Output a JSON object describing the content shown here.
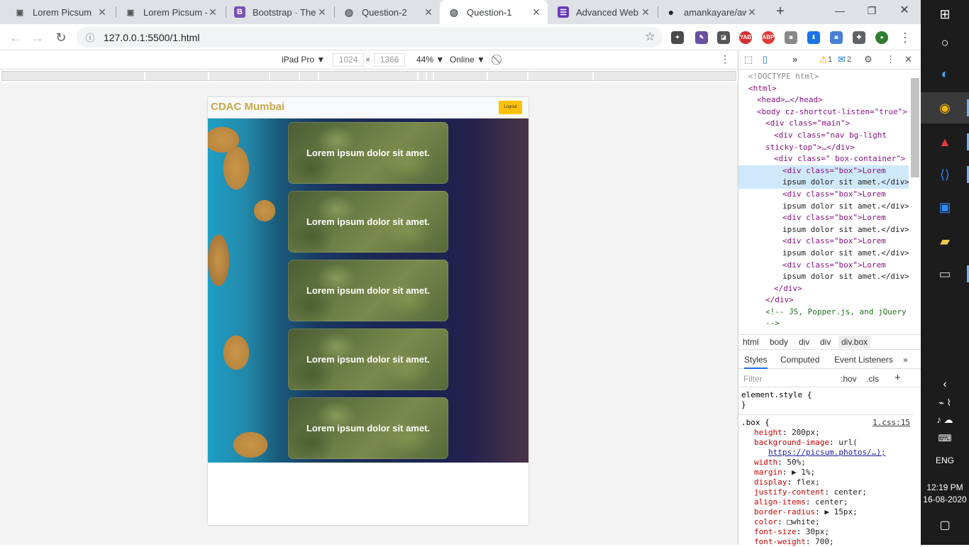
{
  "browser": {
    "tabs": [
      {
        "title": "Lorem Picsum"
      },
      {
        "title": "Lorem Picsum - I"
      },
      {
        "title": "Bootstrap · The r"
      },
      {
        "title": "Question-2"
      },
      {
        "title": "Question-1"
      },
      {
        "title": "Advanced Web P"
      },
      {
        "title": "amankayare/awp"
      }
    ],
    "new_tab": "+",
    "url": "127.0.0.1:5500/1.html"
  },
  "device_toolbar": {
    "device": "iPad Pro ▼",
    "width": "1024",
    "height": "1366",
    "times": "×",
    "zoom": "44% ▼",
    "network": "Online ▼"
  },
  "page": {
    "brand": "CDAC Mumbai",
    "logout": "Logout",
    "boxes": [
      "Lorem ipsum dolor sit amet.",
      "Lorem ipsum dolor sit amet.",
      "Lorem ipsum dolor sit amet.",
      "Lorem ipsum dolor sit amet.",
      "Lorem ipsum dolor sit amet."
    ]
  },
  "devtools": {
    "warnings": "1",
    "messages": "2",
    "dom": {
      "doctype": "<!DOCTYPE html>",
      "html": "<html>",
      "head": "<head>…</head>",
      "body_open": "<body cz-shortcut-listen=\"true\">",
      "main_open": "<div class=\"main\">",
      "nav_a": "<div class=\"nav bg-light",
      "nav_b": "sticky-top\">…</div>",
      "box_container": "<div class=\" box-container\">",
      "box_line_a": "<div class=\"box\">Lorem",
      "box_line_b": "ipsum dolor sit amet.</div>",
      "close_div": "</div>",
      "comment_a": "<!-- JS, Popper.js, and jQuery",
      "comment_b": "-->"
    },
    "breadcrumbs": [
      "html",
      "body",
      "div",
      "div",
      "div.box"
    ],
    "style_tabs": [
      "Styles",
      "Computed",
      "Event Listeners"
    ],
    "filter_placeholder": "Filter",
    "hov": ":hov",
    "cls": ".cls",
    "element_style": "element.style {",
    "element_close": "}",
    "rule_selector": ".box {",
    "rule_source": "1.css:15",
    "declarations": [
      {
        "prop": "height",
        "val": "200px;"
      },
      {
        "prop": "background-image",
        "val": "url("
      },
      {
        "prop": "",
        "val": "https://picsum.photos/…);"
      },
      {
        "prop": "width",
        "val": "50%;"
      },
      {
        "prop": "margin",
        "val": "▶ 1%;"
      },
      {
        "prop": "display",
        "val": "flex;"
      },
      {
        "prop": "justify-content",
        "val": "center;"
      },
      {
        "prop": "align-items",
        "val": "center;"
      },
      {
        "prop": "border-radius",
        "val": "▶ 15px;"
      },
      {
        "prop": "color",
        "val": "□white;"
      },
      {
        "prop": "font-size",
        "val": "30px;"
      },
      {
        "prop": "font-weight",
        "val": "700;"
      }
    ]
  },
  "taskbar": {
    "language": "ENG",
    "time": "12:19 PM",
    "date": "16-08-2020"
  }
}
